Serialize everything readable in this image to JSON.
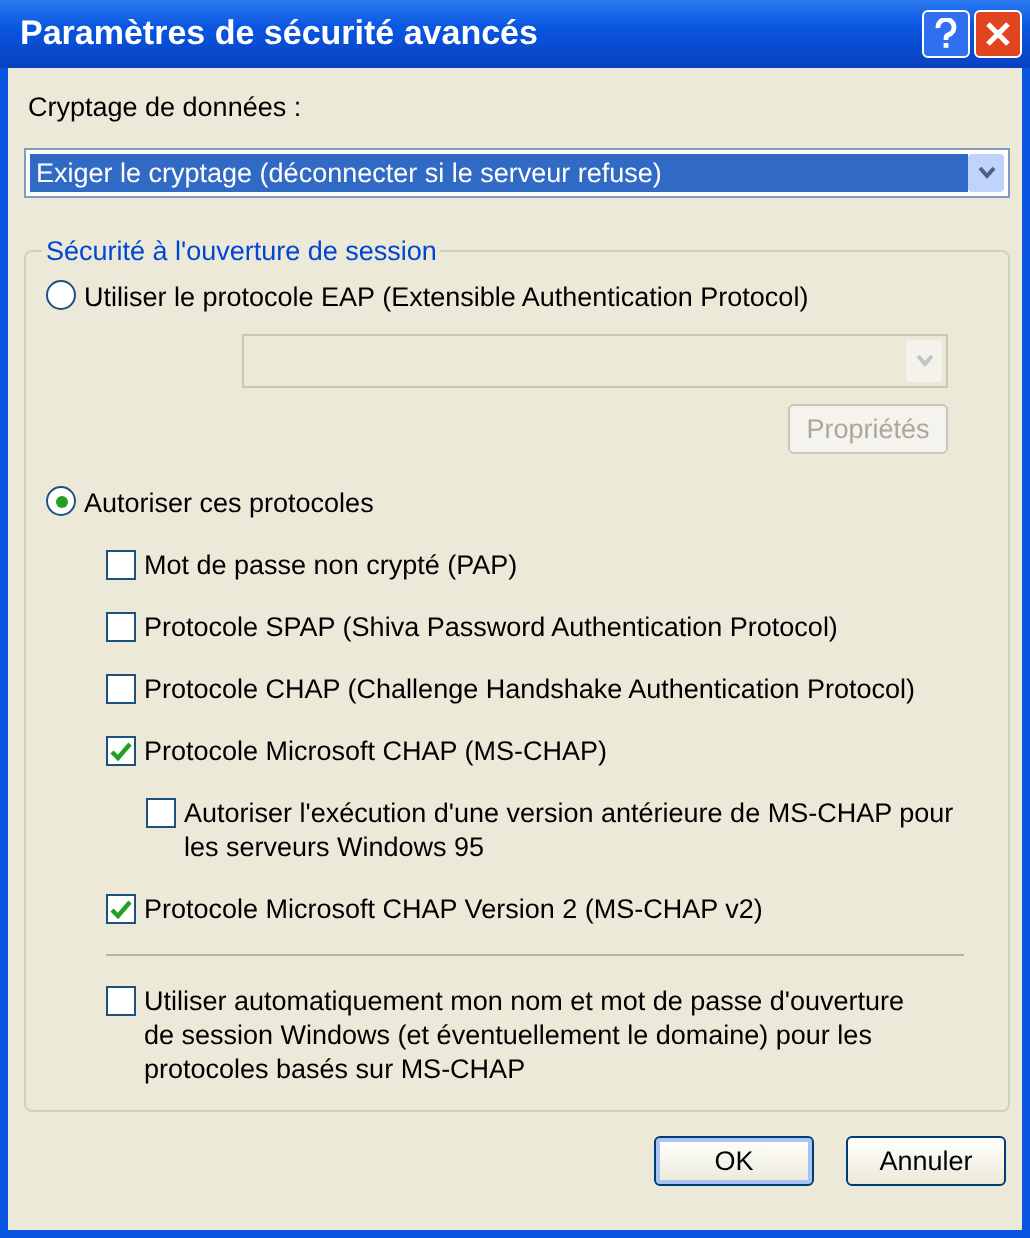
{
  "window": {
    "title": "Paramètres de sécurité avancés"
  },
  "encryption": {
    "label": "Cryptage de données :",
    "value": "Exiger le cryptage (déconnecter si le serveur refuse)"
  },
  "logon_security": {
    "legend": "Sécurité à l'ouverture de session",
    "eap": {
      "label": "Utiliser le protocole EAP (Extensible Authentication Protocol)",
      "selected": false,
      "dropdown": {
        "disabled": true
      },
      "properties_button": {
        "label": "Propriétés",
        "disabled": true
      }
    },
    "allow": {
      "label": "Autoriser ces protocoles",
      "selected": true,
      "protocols": [
        {
          "label": "Mot de passe non crypté (PAP)",
          "checked": false
        },
        {
          "label": "Protocole SPAP (Shiva Password Authentication Protocol)",
          "checked": false
        },
        {
          "label": "Protocole CHAP (Challenge Handshake Authentication Protocol)",
          "checked": false
        },
        {
          "label": "Protocole Microsoft CHAP (MS-CHAP)",
          "checked": true,
          "children": [
            {
              "label": "Autoriser l'exécution d'une version antérieure de MS-CHAP pour les serveurs Windows 95",
              "checked": false
            }
          ]
        },
        {
          "label": "Protocole Microsoft CHAP Version 2 (MS-CHAP v2)",
          "checked": true
        }
      ]
    },
    "auto_logon": {
      "label": "Utiliser automatiquement mon nom et mot de passe d'ouverture de session Windows (et éventuellement le domaine) pour les protocoles basés sur MS-CHAP",
      "checked": false
    }
  },
  "buttons": [
    {
      "label": "OK",
      "default": true
    },
    {
      "label": "Annuler",
      "default": false
    }
  ]
}
